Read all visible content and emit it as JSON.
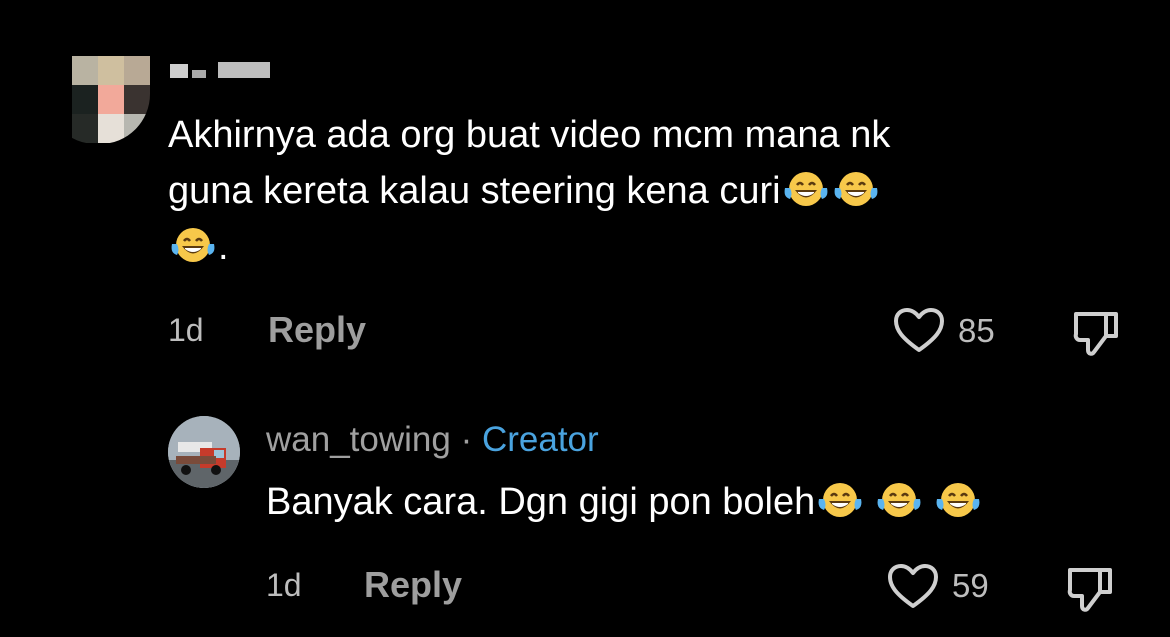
{
  "comment": {
    "text_line1": "Akhirnya ada org buat video mcm mana nk",
    "text_line2": "guna kereta kalau steering kena curi",
    "text_end": ".",
    "time": "1d",
    "reply_label": "Reply",
    "likes": "85",
    "emoji": "face-with-tears-of-joy"
  },
  "reply": {
    "username": "wan_towing",
    "separator": "·",
    "badge": "Creator",
    "text": "Banyak cara. Dgn gigi pon boleh",
    "time": "1d",
    "reply_label": "Reply",
    "likes": "59"
  },
  "colors": {
    "background": "#000000",
    "creator_badge": "#4aa3df",
    "muted_text": "#9e9e9e"
  }
}
